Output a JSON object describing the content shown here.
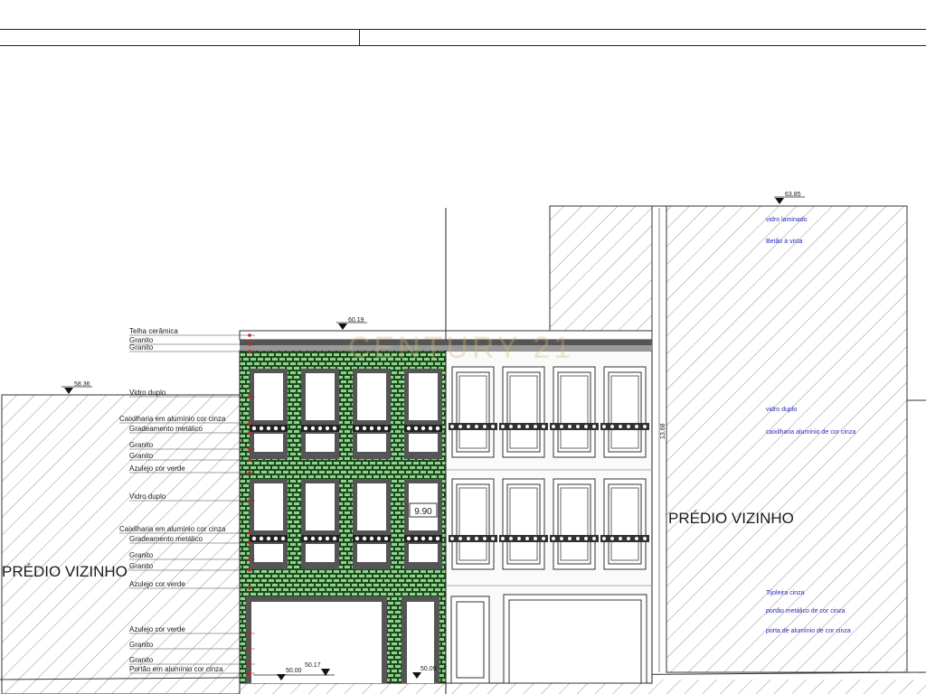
{
  "title_block": {
    "cells": [
      "",
      ""
    ]
  },
  "elevations": {
    "left_neighbor_top": "58.36",
    "building_top": "60.19",
    "right_neighbor_top": "63.85",
    "street_left": "50.17",
    "ground": "50.00",
    "street_right": "50.09"
  },
  "dimensions": {
    "building_height": "9.90",
    "neighbor_height": "13.68"
  },
  "neighbor_label_left": "PRÉDIO VIZINHO",
  "neighbor_label_right": "PRÉDIO VIZINHO",
  "watermark": "CENTURY 21",
  "material_labels_left": [
    "Telha cerâmica",
    "Granito",
    "Granito",
    "Vidro duplo",
    "Caixilharia em alumínio cor cinza",
    "Gradeamento metálico",
    "Granito",
    "Granito",
    "Azulejo cor verde",
    "Vidro duplo",
    "Caixilharia em alumínio cor cinza",
    "Gradeamento metálico",
    "Granito",
    "Granito",
    "Azulejo cor verde",
    "Azulejo cor verde",
    "Granito",
    "Granito",
    "Portão em alumínio cor cinza"
  ],
  "material_labels_right": [
    "vidro laminado",
    "Betão à vista",
    "vidro duplo",
    "caixilharia alumínio de cor cinza",
    "Tijoleira cinza",
    "portão metálico de cor cinza",
    "porta de alumínio de cor cinza"
  ],
  "colors": {
    "tile_green": "#1c4a1c",
    "tile_light": "#8fd18f",
    "frame_grey": "#555555",
    "annotation_blue": "#2a2ab8",
    "leader_red": "#cc2222"
  }
}
